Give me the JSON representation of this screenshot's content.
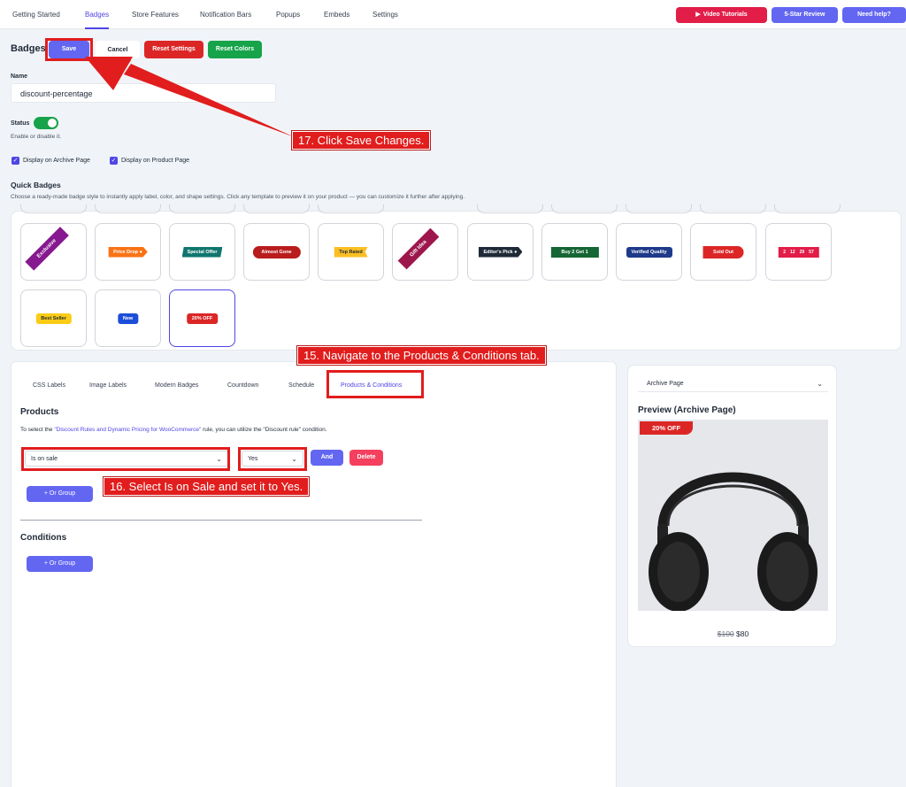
{
  "nav": {
    "tabs": [
      "Getting Started",
      "Badges",
      "Store Features",
      "Notification Bars",
      "Popups",
      "Embeds",
      "Settings"
    ],
    "video": "Video Tutorials",
    "review": "5-Star Review",
    "help": "Need help?"
  },
  "header": {
    "title": "Badges",
    "save": "Save",
    "cancel": "Cancel",
    "reset_settings": "Reset Settings",
    "reset_colors": "Reset Colors"
  },
  "form": {
    "name_label": "Name",
    "name_value": "discount-percentage",
    "status_label": "Status",
    "status_help": "Enable or disable it.",
    "archive_label": "Display on Archive Page",
    "product_label": "Display on Product Page"
  },
  "quick": {
    "title": "Quick Badges",
    "desc": "Choose a ready-made badge style to instantly apply label, color, and shape settings. Click any template to preview it on your product — you can customize it further after applying.",
    "badges": [
      "Exclusive",
      "Price Drop",
      "Special Offer",
      "Almost Gone",
      "Top Rated",
      "Gift Idea",
      "Editor's Pick",
      "Buy 2 Get 1",
      "Verified Quality",
      "Sold Out",
      "Best Seller",
      "New",
      "20% OFF"
    ],
    "countdown": [
      "2",
      "12",
      "29",
      "57"
    ]
  },
  "subtabs": [
    "CSS Labels",
    "Image Labels",
    "Modern Badges",
    "Countdown",
    "Schedule",
    "Products & Conditions"
  ],
  "products": {
    "title": "Products",
    "note_pre": "To select the ",
    "note_link": "\"Discount Rules and Dynamic Pricing for WooCommerce\"",
    "note_post": " rule, you can utilize the \"Discount rule\" condition.",
    "condition": "Is on sale",
    "value": "Yes",
    "and": "And",
    "delete": "Delete",
    "or_group": "+ Or Group"
  },
  "conditions": {
    "title": "Conditions",
    "or_group": "+ Or Group"
  },
  "preview": {
    "select": "Archive Page",
    "title": "Preview (Archive Page)",
    "badge": "20% OFF",
    "old_price": "$100",
    "new_price": "$80"
  },
  "annotations": {
    "a15": "15. Navigate to the Products & Conditions tab.",
    "a16": "16. Select Is on Sale and set it to Yes.",
    "a17": "17. Click Save Changes."
  },
  "colors": {
    "accent": "#6366f1",
    "red": "#dc2626",
    "green": "#16a34a",
    "annotation": "#e11d1d"
  }
}
